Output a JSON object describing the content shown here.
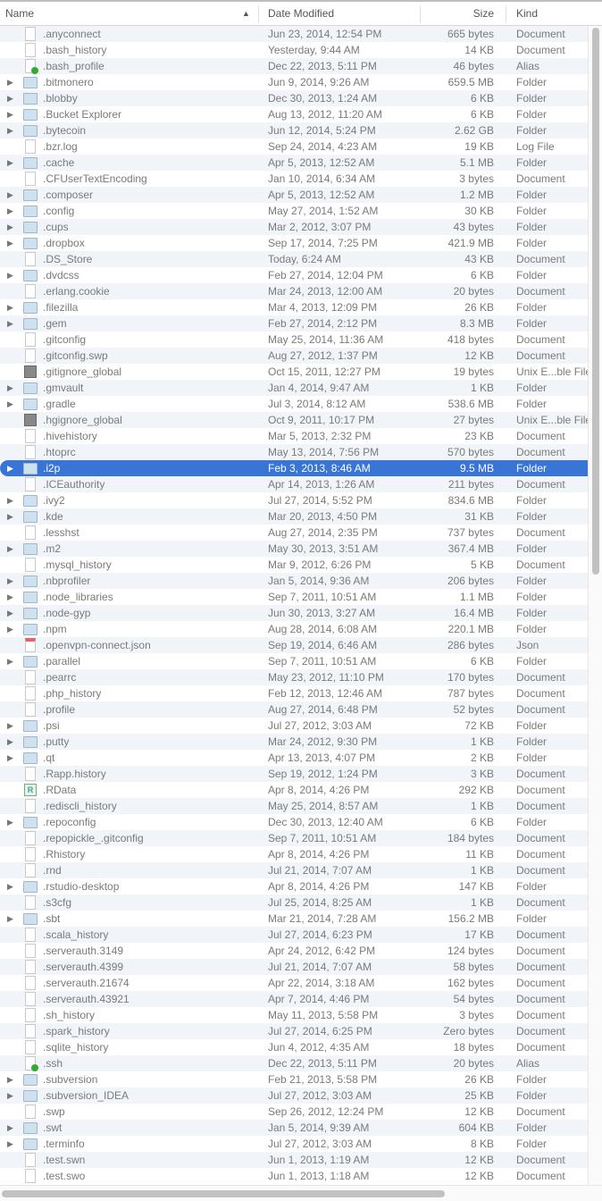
{
  "header": {
    "name": "Name",
    "date": "Date Modified",
    "size": "Size",
    "kind": "Kind",
    "sort_indicator": "▲"
  },
  "selected_row": ".i2p",
  "rows": [
    {
      "icon": "doc",
      "name": ".anyconnect",
      "date": "Jun 23, 2014, 12:54 PM",
      "size": "665 bytes",
      "kind": "Document"
    },
    {
      "icon": "doc",
      "name": ".bash_history",
      "date": "Yesterday, 9:44 AM",
      "size": "14 KB",
      "kind": "Document"
    },
    {
      "icon": "alias",
      "name": ".bash_profile",
      "date": "Dec 22, 2013, 5:11 PM",
      "size": "46 bytes",
      "kind": "Alias"
    },
    {
      "icon": "folder",
      "name": ".bitmonero",
      "date": "Jun 9, 2014, 9:26 AM",
      "size": "659.5 MB",
      "kind": "Folder"
    },
    {
      "icon": "folder",
      "name": ".blobby",
      "date": "Dec 30, 2013, 1:24 AM",
      "size": "6 KB",
      "kind": "Folder"
    },
    {
      "icon": "folder",
      "name": ".Bucket Explorer",
      "date": "Aug 13, 2012, 11:20 AM",
      "size": "6 KB",
      "kind": "Folder"
    },
    {
      "icon": "folder",
      "name": ".bytecoin",
      "date": "Jun 12, 2014, 5:24 PM",
      "size": "2.62 GB",
      "kind": "Folder"
    },
    {
      "icon": "doc",
      "name": ".bzr.log",
      "date": "Sep 24, 2014, 4:23 AM",
      "size": "19 KB",
      "kind": "Log File"
    },
    {
      "icon": "folder",
      "name": ".cache",
      "date": "Apr 5, 2013, 12:52 AM",
      "size": "5.1 MB",
      "kind": "Folder"
    },
    {
      "icon": "doc",
      "name": ".CFUserTextEncoding",
      "date": "Jan 10, 2014, 6:34 AM",
      "size": "3 bytes",
      "kind": "Document"
    },
    {
      "icon": "folder",
      "name": ".composer",
      "date": "Apr 5, 2013, 12:52 AM",
      "size": "1.2 MB",
      "kind": "Folder"
    },
    {
      "icon": "folder",
      "name": ".config",
      "date": "May 27, 2014, 1:52 AM",
      "size": "30 KB",
      "kind": "Folder"
    },
    {
      "icon": "folder",
      "name": ".cups",
      "date": "Mar 2, 2012, 3:07 PM",
      "size": "43 bytes",
      "kind": "Folder"
    },
    {
      "icon": "folder",
      "name": ".dropbox",
      "date": "Sep 17, 2014, 7:25 PM",
      "size": "421.9 MB",
      "kind": "Folder"
    },
    {
      "icon": "doc",
      "name": ".DS_Store",
      "date": "Today, 6:24 AM",
      "size": "43 KB",
      "kind": "Document"
    },
    {
      "icon": "folder",
      "name": ".dvdcss",
      "date": "Feb 27, 2014, 12:04 PM",
      "size": "6 KB",
      "kind": "Folder"
    },
    {
      "icon": "doc",
      "name": ".erlang.cookie",
      "date": "Mar 24, 2013, 12:00 AM",
      "size": "20 bytes",
      "kind": "Document"
    },
    {
      "icon": "folder",
      "name": ".filezilla",
      "date": "Mar 4, 2013, 12:09 PM",
      "size": "26 KB",
      "kind": "Folder"
    },
    {
      "icon": "folder",
      "name": ".gem",
      "date": "Feb 27, 2014, 2:12 PM",
      "size": "8.3 MB",
      "kind": "Folder"
    },
    {
      "icon": "doc",
      "name": ".gitconfig",
      "date": "May 25, 2014, 11:36 AM",
      "size": "418 bytes",
      "kind": "Document"
    },
    {
      "icon": "doc",
      "name": ".gitconfig.swp",
      "date": "Aug 27, 2012, 1:37 PM",
      "size": "12 KB",
      "kind": "Document"
    },
    {
      "icon": "unix",
      "name": ".gitignore_global",
      "date": "Oct 15, 2011, 12:27 PM",
      "size": "19 bytes",
      "kind": "Unix E...ble File"
    },
    {
      "icon": "folder",
      "name": ".gmvault",
      "date": "Jan 4, 2014, 9:47 AM",
      "size": "1 KB",
      "kind": "Folder"
    },
    {
      "icon": "folder",
      "name": ".gradle",
      "date": "Jul 3, 2014, 8:12 AM",
      "size": "538.6 MB",
      "kind": "Folder"
    },
    {
      "icon": "unix",
      "name": ".hgignore_global",
      "date": "Oct 9, 2011, 10:17 PM",
      "size": "27 bytes",
      "kind": "Unix E...ble File"
    },
    {
      "icon": "doc",
      "name": ".hivehistory",
      "date": "Mar 5, 2013, 2:32 PM",
      "size": "23 KB",
      "kind": "Document"
    },
    {
      "icon": "doc",
      "name": ".htoprc",
      "date": "May 13, 2014, 7:56 PM",
      "size": "570 bytes",
      "kind": "Document"
    },
    {
      "icon": "folder",
      "name": ".i2p",
      "date": "Feb 3, 2013, 8:46 AM",
      "size": "9.5 MB",
      "kind": "Folder"
    },
    {
      "icon": "doc",
      "name": ".ICEauthority",
      "date": "Apr 14, 2013, 1:26 AM",
      "size": "211 bytes",
      "kind": "Document"
    },
    {
      "icon": "folder",
      "name": ".ivy2",
      "date": "Jul 27, 2014, 5:52 PM",
      "size": "834.6 MB",
      "kind": "Folder"
    },
    {
      "icon": "folder",
      "name": ".kde",
      "date": "Mar 20, 2013, 4:50 PM",
      "size": "31 KB",
      "kind": "Folder"
    },
    {
      "icon": "doc",
      "name": ".lesshst",
      "date": "Aug 27, 2014, 2:35 PM",
      "size": "737 bytes",
      "kind": "Document"
    },
    {
      "icon": "folder",
      "name": ".m2",
      "date": "May 30, 2013, 3:51 AM",
      "size": "367.4 MB",
      "kind": "Folder"
    },
    {
      "icon": "doc",
      "name": ".mysql_history",
      "date": "Mar 9, 2012, 6:26 PM",
      "size": "5 KB",
      "kind": "Document"
    },
    {
      "icon": "folder",
      "name": ".nbprofiler",
      "date": "Jan 5, 2014, 9:36 AM",
      "size": "206 bytes",
      "kind": "Folder"
    },
    {
      "icon": "folder",
      "name": ".node_libraries",
      "date": "Sep 7, 2011, 10:51 AM",
      "size": "1.1 MB",
      "kind": "Folder"
    },
    {
      "icon": "folder",
      "name": ".node-gyp",
      "date": "Jun 30, 2013, 3:27 AM",
      "size": "16.4 MB",
      "kind": "Folder"
    },
    {
      "icon": "folder",
      "name": ".npm",
      "date": "Aug 28, 2014, 6:08 AM",
      "size": "220.1 MB",
      "kind": "Folder"
    },
    {
      "icon": "json",
      "name": ".openvpn-connect.json",
      "date": "Sep 19, 2014, 6:46 AM",
      "size": "286 bytes",
      "kind": "Json"
    },
    {
      "icon": "folder",
      "name": ".parallel",
      "date": "Sep 7, 2011, 10:51 AM",
      "size": "6 KB",
      "kind": "Folder"
    },
    {
      "icon": "doc",
      "name": ".pearrc",
      "date": "May 23, 2012, 11:10 PM",
      "size": "170 bytes",
      "kind": "Document"
    },
    {
      "icon": "doc",
      "name": ".php_history",
      "date": "Feb 12, 2013, 12:46 AM",
      "size": "787 bytes",
      "kind": "Document"
    },
    {
      "icon": "doc",
      "name": ".profile",
      "date": "Aug 27, 2014, 6:48 PM",
      "size": "52 bytes",
      "kind": "Document"
    },
    {
      "icon": "folder",
      "name": ".psi",
      "date": "Jul 27, 2012, 3:03 AM",
      "size": "72 KB",
      "kind": "Folder"
    },
    {
      "icon": "folder",
      "name": ".putty",
      "date": "Mar 24, 2012, 9:30 PM",
      "size": "1 KB",
      "kind": "Folder"
    },
    {
      "icon": "folder",
      "name": ".qt",
      "date": "Apr 13, 2013, 4:07 PM",
      "size": "2 KB",
      "kind": "Folder"
    },
    {
      "icon": "doc",
      "name": ".Rapp.history",
      "date": "Sep 19, 2012, 1:24 PM",
      "size": "3 KB",
      "kind": "Document"
    },
    {
      "icon": "r",
      "name": ".RData",
      "date": "Apr 8, 2014, 4:26 PM",
      "size": "292 KB",
      "kind": "Document"
    },
    {
      "icon": "doc",
      "name": ".rediscli_history",
      "date": "May 25, 2014, 8:57 AM",
      "size": "1 KB",
      "kind": "Document"
    },
    {
      "icon": "folder",
      "name": ".repoconfig",
      "date": "Dec 30, 2013, 12:40 AM",
      "size": "6 KB",
      "kind": "Folder"
    },
    {
      "icon": "doc",
      "name": ".repopickle_.gitconfig",
      "date": "Sep 7, 2011, 10:51 AM",
      "size": "184 bytes",
      "kind": "Document"
    },
    {
      "icon": "doc",
      "name": ".Rhistory",
      "date": "Apr 8, 2014, 4:26 PM",
      "size": "11 KB",
      "kind": "Document"
    },
    {
      "icon": "doc",
      "name": ".rnd",
      "date": "Jul 21, 2014, 7:07 AM",
      "size": "1 KB",
      "kind": "Document"
    },
    {
      "icon": "folder",
      "name": ".rstudio-desktop",
      "date": "Apr 8, 2014, 4:26 PM",
      "size": "147 KB",
      "kind": "Folder"
    },
    {
      "icon": "doc",
      "name": ".s3cfg",
      "date": "Jul 25, 2014, 8:25 AM",
      "size": "1 KB",
      "kind": "Document"
    },
    {
      "icon": "folder",
      "name": ".sbt",
      "date": "Mar 21, 2014, 7:28 AM",
      "size": "156.2 MB",
      "kind": "Folder"
    },
    {
      "icon": "doc",
      "name": ".scala_history",
      "date": "Jul 27, 2014, 6:23 PM",
      "size": "17 KB",
      "kind": "Document"
    },
    {
      "icon": "doc",
      "name": ".serverauth.3149",
      "date": "Apr 24, 2012, 6:42 PM",
      "size": "124 bytes",
      "kind": "Document"
    },
    {
      "icon": "doc",
      "name": ".serverauth.4399",
      "date": "Jul 21, 2014, 7:07 AM",
      "size": "58 bytes",
      "kind": "Document"
    },
    {
      "icon": "doc",
      "name": ".serverauth.21674",
      "date": "Apr 22, 2014, 3:18 AM",
      "size": "162 bytes",
      "kind": "Document"
    },
    {
      "icon": "doc",
      "name": ".serverauth.43921",
      "date": "Apr 7, 2014, 4:46 PM",
      "size": "54 bytes",
      "kind": "Document"
    },
    {
      "icon": "doc",
      "name": ".sh_history",
      "date": "May 11, 2013, 5:58 PM",
      "size": "3 bytes",
      "kind": "Document"
    },
    {
      "icon": "doc",
      "name": ".spark_history",
      "date": "Jul 27, 2014, 6:25 PM",
      "size": "Zero bytes",
      "kind": "Document"
    },
    {
      "icon": "doc",
      "name": ".sqlite_history",
      "date": "Jun 4, 2012, 4:35 AM",
      "size": "18 bytes",
      "kind": "Document"
    },
    {
      "icon": "alias",
      "name": ".ssh",
      "date": "Dec 22, 2013, 5:11 PM",
      "size": "20 bytes",
      "kind": "Alias"
    },
    {
      "icon": "folder",
      "name": ".subversion",
      "date": "Feb 21, 2013, 5:58 PM",
      "size": "26 KB",
      "kind": "Folder"
    },
    {
      "icon": "folder",
      "name": ".subversion_IDEA",
      "date": "Jul 27, 2012, 3:03 AM",
      "size": "25 KB",
      "kind": "Folder"
    },
    {
      "icon": "doc",
      "name": ".swp",
      "date": "Sep 26, 2012, 12:24 PM",
      "size": "12 KB",
      "kind": "Document"
    },
    {
      "icon": "folder",
      "name": ".swt",
      "date": "Jan 5, 2014, 9:39 AM",
      "size": "604 KB",
      "kind": "Folder"
    },
    {
      "icon": "folder",
      "name": ".terminfo",
      "date": "Jul 27, 2012, 3:03 AM",
      "size": "8 KB",
      "kind": "Folder"
    },
    {
      "icon": "doc",
      "name": ".test.swn",
      "date": "Jun 1, 2013, 1:19 AM",
      "size": "12 KB",
      "kind": "Document"
    },
    {
      "icon": "doc",
      "name": ".test.swo",
      "date": "Jun 1, 2013, 1:18 AM",
      "size": "12 KB",
      "kind": "Document"
    }
  ]
}
